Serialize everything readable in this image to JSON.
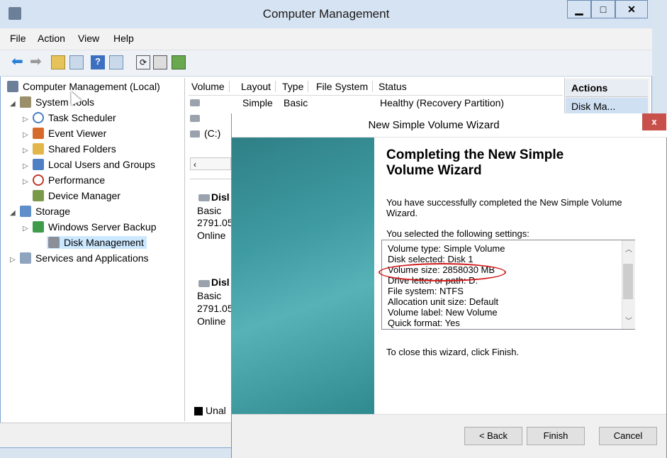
{
  "window": {
    "title": "Computer Management"
  },
  "menu": [
    "File",
    "Action",
    "View",
    "Help"
  ],
  "tree": [
    {
      "label": "Computer Management (Local)",
      "indent": 0,
      "arrow": ""
    },
    {
      "label": "System Tools",
      "indent": 1,
      "arrow": "◢"
    },
    {
      "label": "Task Scheduler",
      "indent": 2,
      "arrow": "▷"
    },
    {
      "label": "Event Viewer",
      "indent": 2,
      "arrow": "▷"
    },
    {
      "label": "Shared Folders",
      "indent": 2,
      "arrow": "▷"
    },
    {
      "label": "Local Users and Groups",
      "indent": 2,
      "arrow": "▷"
    },
    {
      "label": "Performance",
      "indent": 2,
      "arrow": "▷"
    },
    {
      "label": "Device Manager",
      "indent": 2,
      "arrow": ""
    },
    {
      "label": "Storage",
      "indent": 1,
      "arrow": "◢"
    },
    {
      "label": "Windows Server Backup",
      "indent": 2,
      "arrow": "▷"
    },
    {
      "label": "Disk Management",
      "indent": 2,
      "arrow": ""
    },
    {
      "label": "Services and Applications",
      "indent": 1,
      "arrow": "▷"
    }
  ],
  "volume_list": {
    "columns": [
      "Volume",
      "Layout",
      "Type",
      "File System",
      "Status"
    ],
    "rows": [
      {
        "volume": "",
        "layout": "Simple",
        "type": "Basic",
        "fs": "",
        "status": "Healthy (Recovery Partition)"
      },
      {
        "volume": "",
        "layout": "",
        "type": "",
        "fs": "",
        "status": ""
      },
      {
        "volume": "(C:)",
        "layout": "",
        "type": "",
        "fs": "",
        "status": ""
      }
    ]
  },
  "disks": [
    {
      "name": "Disl",
      "type": "Basic",
      "size": "2791.05",
      "state": "Online"
    },
    {
      "name": "Disl",
      "type": "Basic",
      "size": "2791.05",
      "state": "Online"
    }
  ],
  "legend_unallocated": "Unal",
  "actions": {
    "header": "Actions",
    "item": "Disk Ma..."
  },
  "dialog": {
    "title": "New Simple Volume Wizard",
    "heading_line1": "Completing the New Simple",
    "heading_line2": "Volume Wizard",
    "success_text": "You have successfully completed the New Simple Volume Wizard.",
    "settings_label": "You selected the following settings:",
    "settings": [
      "Volume type: Simple Volume",
      "Disk selected: Disk 1",
      "Volume size: 2858030 MB",
      "Drive letter or path: D:",
      "File system: NTFS",
      "Allocation unit size: Default",
      "Volume label: New Volume",
      "Quick format: Yes"
    ],
    "close_text": "To close this wizard, click Finish.",
    "back_label": "< Back",
    "finish_label": "Finish",
    "cancel_label": "Cancel"
  },
  "colors": {
    "highlight_circle": "#d11a1a",
    "selected_tree": "#cce8ff",
    "banner": "#3e9aa1"
  }
}
